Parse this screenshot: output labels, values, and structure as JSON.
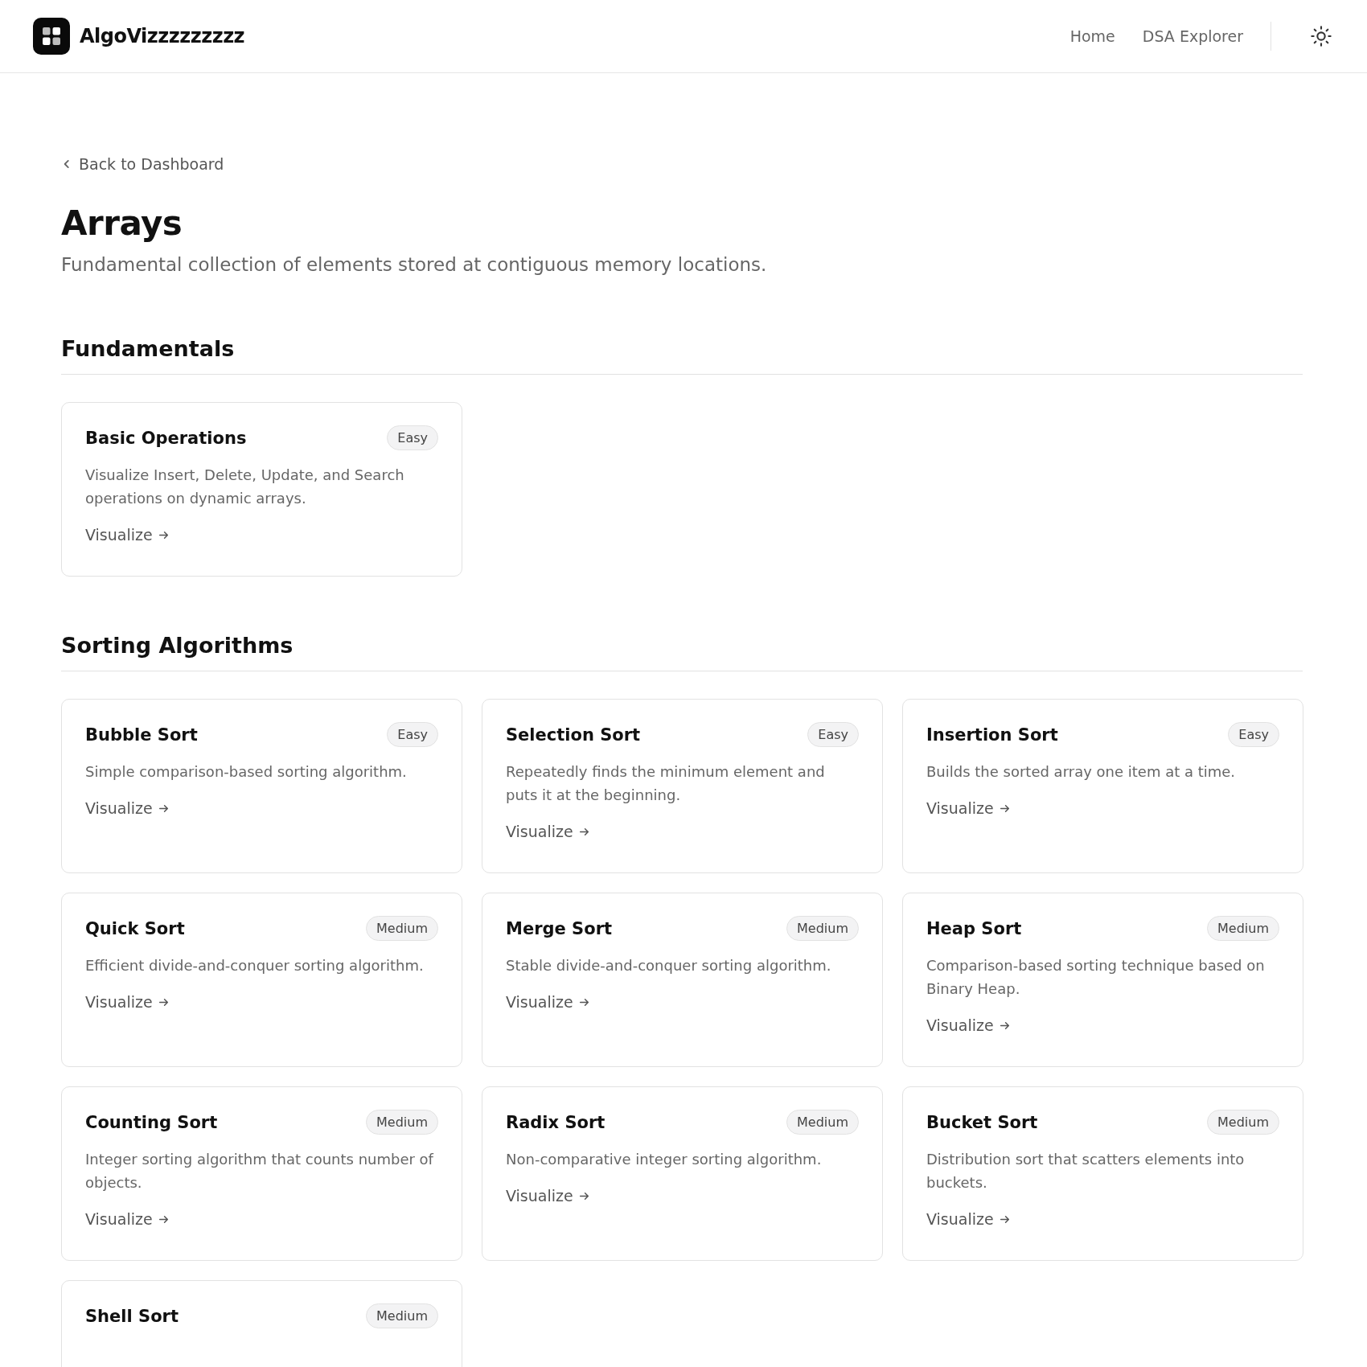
{
  "header": {
    "brand": "AlgoVizzzzzzzzz",
    "nav": [
      "Home",
      "DSA Explorer"
    ]
  },
  "back_link": "Back to Dashboard",
  "page": {
    "title": "Arrays",
    "subtitle": "Fundamental collection of elements stored at contiguous memory locations."
  },
  "sections": [
    {
      "title": "Fundamentals",
      "cards": [
        {
          "title": "Basic Operations",
          "badge": "Easy",
          "description": "Visualize Insert, Delete, Update, and Search operations on dynamic arrays.",
          "link": "Visualize"
        }
      ]
    },
    {
      "title": "Sorting Algorithms",
      "cards": [
        {
          "title": "Bubble Sort",
          "badge": "Easy",
          "description": "Simple comparison-based sorting algorithm.",
          "link": "Visualize"
        },
        {
          "title": "Selection Sort",
          "badge": "Easy",
          "description": "Repeatedly finds the minimum element and puts it at the beginning.",
          "link": "Visualize"
        },
        {
          "title": "Insertion Sort",
          "badge": "Easy",
          "description": "Builds the sorted array one item at a time.",
          "link": "Visualize"
        },
        {
          "title": "Quick Sort",
          "badge": "Medium",
          "description": "Efficient divide-and-conquer sorting algorithm.",
          "link": "Visualize"
        },
        {
          "title": "Merge Sort",
          "badge": "Medium",
          "description": "Stable divide-and-conquer sorting algorithm.",
          "link": "Visualize"
        },
        {
          "title": "Heap Sort",
          "badge": "Medium",
          "description": "Comparison-based sorting technique based on Binary Heap.",
          "link": "Visualize"
        },
        {
          "title": "Counting Sort",
          "badge": "Medium",
          "description": "Integer sorting algorithm that counts number of objects.",
          "link": "Visualize"
        },
        {
          "title": "Radix Sort",
          "badge": "Medium",
          "description": "Non-comparative integer sorting algorithm.",
          "link": "Visualize"
        },
        {
          "title": "Bucket Sort",
          "badge": "Medium",
          "description": "Distribution sort that scatters elements into buckets.",
          "link": "Visualize"
        },
        {
          "title": "Shell Sort",
          "badge": "Medium"
        }
      ]
    }
  ]
}
